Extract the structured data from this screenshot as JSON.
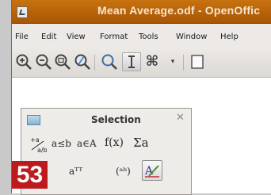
{
  "window": {
    "title": "Mean Average.odf - OpenOffic"
  },
  "menu": [
    "File",
    "Edit",
    "View",
    "Format",
    "Tools",
    "Window",
    "Help"
  ],
  "toolbar": {
    "buttons": [
      "zoom-in-icon",
      "zoom-out-icon",
      "zoom-100-icon",
      "show-all-icon",
      "update-icon",
      "formula-cursor-icon",
      "symbols-icon"
    ]
  },
  "selection_panel": {
    "title": "Selection",
    "row1": [
      "a≤b",
      "a∈A",
      "f(x)",
      "Σa"
    ],
    "row2": [
      "aᵀᵀ",
      "(ᵃᵇ)"
    ]
  },
  "badge": {
    "number": "53"
  },
  "colors": {
    "titlebar": "#b6600a",
    "badge": "#bd1a1e",
    "window": "#ece9e6"
  }
}
